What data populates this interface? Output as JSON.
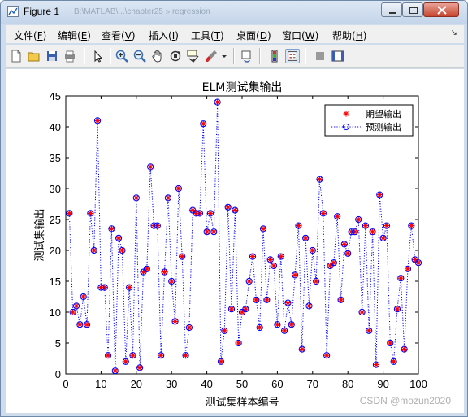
{
  "window": {
    "title": "Figure 1",
    "ghost_title": "B:\\MATLAB\\...\\chapter25 » regression"
  },
  "menu": {
    "items": [
      {
        "label": "文件(",
        "key": "F",
        "end": ")"
      },
      {
        "label": "编辑(",
        "key": "E",
        "end": ")"
      },
      {
        "label": "查看(",
        "key": "V",
        "end": ")"
      },
      {
        "label": "插入(",
        "key": "I",
        "end": ")"
      },
      {
        "label": "工具(",
        "key": "T",
        "end": ")"
      },
      {
        "label": "桌面(",
        "key": "D",
        "end": ")"
      },
      {
        "label": "窗口(",
        "key": "W",
        "end": ")"
      },
      {
        "label": "帮助(",
        "key": "H",
        "end": ")"
      }
    ],
    "dock_glyph": "↘"
  },
  "toolbar": {
    "icons": [
      "new-figure-icon",
      "open-file-icon",
      "save-icon",
      "print-icon",
      "edit-plot-arrow-icon",
      "zoom-in-icon",
      "zoom-out-icon",
      "pan-hand-icon",
      "rotate-3d-icon",
      "data-cursor-icon",
      "brush-icon",
      "link-plot-icon",
      "colorbar-icon",
      "legend-icon",
      "hide-plot-tools-icon",
      "show-plot-tools-icon"
    ]
  },
  "watermark": "CSDN @mozun2020",
  "colors": {
    "series1": "#ff0000",
    "series2": "#0000ff",
    "axes_bg": "#ffffff",
    "figure_bg": "#ffffff"
  },
  "chart_data": {
    "type": "line",
    "title": "ELM测试集输出",
    "xlabel": "测试集样本编号",
    "ylabel": "测试集输出",
    "xlim": [
      0,
      100
    ],
    "ylim": [
      0,
      45
    ],
    "xticks": [
      0,
      10,
      20,
      30,
      40,
      50,
      60,
      70,
      80,
      90,
      100
    ],
    "yticks": [
      0,
      5,
      10,
      15,
      20,
      25,
      30,
      35,
      40,
      45
    ],
    "grid": false,
    "legend_position": "top-right",
    "x": [
      1,
      2,
      3,
      4,
      5,
      6,
      7,
      8,
      9,
      10,
      11,
      12,
      13,
      14,
      15,
      16,
      17,
      18,
      19,
      20,
      21,
      22,
      23,
      24,
      25,
      26,
      27,
      28,
      29,
      30,
      31,
      32,
      33,
      34,
      35,
      36,
      37,
      38,
      39,
      40,
      41,
      42,
      43,
      44,
      45,
      46,
      47,
      48,
      49,
      50,
      51,
      52,
      53,
      54,
      55,
      56,
      57,
      58,
      59,
      60,
      61,
      62,
      63,
      64,
      65,
      66,
      67,
      68,
      69,
      70,
      71,
      72,
      73,
      74,
      75,
      76,
      77,
      78,
      79,
      80,
      81,
      82,
      83,
      84,
      85,
      86,
      87,
      88,
      89,
      90,
      91,
      92,
      93,
      94,
      95,
      96,
      97,
      98,
      99,
      100
    ],
    "series": [
      {
        "name": "期望输出",
        "marker": "*",
        "color": "#ff0000",
        "line": "none",
        "values": [
          26,
          10,
          11,
          8,
          12.5,
          8,
          26,
          20,
          41,
          14,
          14,
          3,
          23.5,
          0.5,
          22,
          20,
          2,
          14,
          3,
          28.5,
          1,
          16.5,
          17,
          33.5,
          24,
          24,
          3,
          16.5,
          28.5,
          15,
          8.5,
          30,
          19,
          3,
          7.5,
          26.5,
          26,
          26,
          40.5,
          23,
          26,
          23,
          44,
          2,
          7,
          27,
          10.5,
          26.5,
          5,
          10,
          10.5,
          15,
          19,
          12,
          7.5,
          23.5,
          12,
          18.5,
          17.5,
          8,
          19,
          7,
          11.5,
          8,
          16,
          24,
          4,
          22,
          11,
          20,
          15,
          31.5,
          26,
          3,
          17.5,
          18,
          25.5,
          12,
          21,
          19.5,
          23,
          23,
          25,
          10,
          24,
          7,
          23,
          1.5,
          29,
          22,
          24,
          5,
          2,
          10.5,
          15.5,
          4,
          17,
          24,
          18.5,
          18
        ]
      },
      {
        "name": "预测输出",
        "marker": "o",
        "color": "#0000ff",
        "line": "dotted",
        "values": [
          26,
          10,
          11,
          8,
          12.5,
          8,
          26,
          20,
          41,
          14,
          14,
          3,
          23.5,
          0.5,
          22,
          20,
          2,
          14,
          3,
          28.5,
          1,
          16.5,
          17,
          33.5,
          24,
          24,
          3,
          16.5,
          28.5,
          15,
          8.5,
          30,
          19,
          3,
          7.5,
          26.5,
          26,
          26,
          40.5,
          23,
          26,
          23,
          44,
          2,
          7,
          27,
          10.5,
          26.5,
          5,
          10,
          10.5,
          15,
          19,
          12,
          7.5,
          23.5,
          12,
          18.5,
          17.5,
          8,
          19,
          7,
          11.5,
          8,
          16,
          24,
          4,
          22,
          11,
          20,
          15,
          31.5,
          26,
          3,
          17.5,
          18,
          25.5,
          12,
          21,
          19.5,
          23,
          23,
          25,
          10,
          24,
          7,
          23,
          1.5,
          29,
          22,
          24,
          5,
          2,
          10.5,
          15.5,
          4,
          17,
          24,
          18.5,
          18
        ]
      }
    ]
  }
}
